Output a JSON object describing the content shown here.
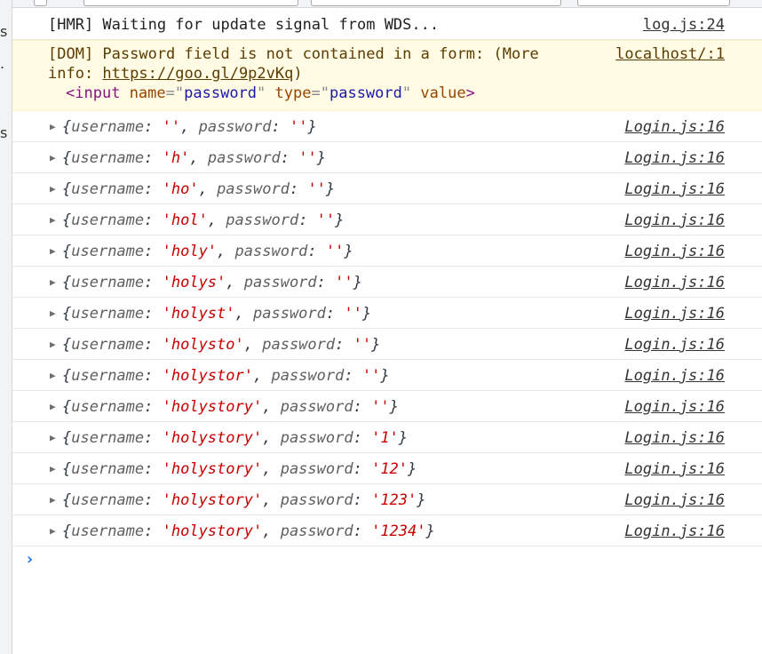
{
  "left_strip": [
    "s",
    ".",
    "s"
  ],
  "messages": {
    "hmr": {
      "text": "[HMR] Waiting for update signal from WDS...",
      "source": "log.js:24"
    },
    "dom_warning": {
      "text_part1": "[DOM] Password field is not contained in a form: (More",
      "text_part2": "info: ",
      "link": "https://goo.gl/9p2vKq",
      "text_part3": ")",
      "element": {
        "open": "<",
        "tag": "input",
        "name_attr": "name",
        "name_eq": "=",
        "name_q1": "\"",
        "name_val": "password",
        "name_q2": "\"",
        "type_attr": "type",
        "type_eq": "=",
        "type_q1": "\"",
        "type_val": "password",
        "type_q2": "\"",
        "value_attr": "value",
        "close": ">"
      },
      "source": "localhost/:1"
    }
  },
  "log_entries": [
    {
      "open": "{",
      "k1": "username",
      "c1": ": ",
      "v1": "''",
      "sep": ", ",
      "k2": "password",
      "c2": ": ",
      "v2": "''",
      "close": "}",
      "source": "Login.js:16"
    },
    {
      "open": "{",
      "k1": "username",
      "c1": ": ",
      "v1": "'h'",
      "sep": ", ",
      "k2": "password",
      "c2": ": ",
      "v2": "''",
      "close": "}",
      "source": "Login.js:16"
    },
    {
      "open": "{",
      "k1": "username",
      "c1": ": ",
      "v1": "'ho'",
      "sep": ", ",
      "k2": "password",
      "c2": ": ",
      "v2": "''",
      "close": "}",
      "source": "Login.js:16"
    },
    {
      "open": "{",
      "k1": "username",
      "c1": ": ",
      "v1": "'hol'",
      "sep": ", ",
      "k2": "password",
      "c2": ": ",
      "v2": "''",
      "close": "}",
      "source": "Login.js:16"
    },
    {
      "open": "{",
      "k1": "username",
      "c1": ": ",
      "v1": "'holy'",
      "sep": ", ",
      "k2": "password",
      "c2": ": ",
      "v2": "''",
      "close": "}",
      "source": "Login.js:16"
    },
    {
      "open": "{",
      "k1": "username",
      "c1": ": ",
      "v1": "'holys'",
      "sep": ", ",
      "k2": "password",
      "c2": ": ",
      "v2": "''",
      "close": "}",
      "source": "Login.js:16"
    },
    {
      "open": "{",
      "k1": "username",
      "c1": ": ",
      "v1": "'holyst'",
      "sep": ", ",
      "k2": "password",
      "c2": ": ",
      "v2": "''",
      "close": "}",
      "source": "Login.js:16"
    },
    {
      "open": "{",
      "k1": "username",
      "c1": ": ",
      "v1": "'holysto'",
      "sep": ", ",
      "k2": "password",
      "c2": ": ",
      "v2": "''",
      "close": "}",
      "source": "Login.js:16"
    },
    {
      "open": "{",
      "k1": "username",
      "c1": ": ",
      "v1": "'holystor'",
      "sep": ", ",
      "k2": "password",
      "c2": ": ",
      "v2": "''",
      "close": "}",
      "source": "Login.js:16"
    },
    {
      "open": "{",
      "k1": "username",
      "c1": ": ",
      "v1": "'holystory'",
      "sep": ", ",
      "k2": "password",
      "c2": ": ",
      "v2": "''",
      "close": "}",
      "source": "Login.js:16"
    },
    {
      "open": "{",
      "k1": "username",
      "c1": ": ",
      "v1": "'holystory'",
      "sep": ", ",
      "k2": "password",
      "c2": ": ",
      "v2": "'1'",
      "close": "}",
      "source": "Login.js:16"
    },
    {
      "open": "{",
      "k1": "username",
      "c1": ": ",
      "v1": "'holystory'",
      "sep": ", ",
      "k2": "password",
      "c2": ": ",
      "v2": "'12'",
      "close": "}",
      "source": "Login.js:16"
    },
    {
      "open": "{",
      "k1": "username",
      "c1": ": ",
      "v1": "'holystory'",
      "sep": ", ",
      "k2": "password",
      "c2": ": ",
      "v2": "'123'",
      "close": "}",
      "source": "Login.js:16"
    },
    {
      "open": "{",
      "k1": "username",
      "c1": ": ",
      "v1": "'holystory'",
      "sep": ", ",
      "k2": "password",
      "c2": ": ",
      "v2": "'1234'",
      "close": "}",
      "source": "Login.js:16"
    }
  ],
  "prompt": {
    "caret": "›",
    "value": ""
  },
  "icons": {
    "expand": "triangle-right-icon",
    "prompt": "chevron-right-icon"
  },
  "colors": {
    "string": "#c80000",
    "warning_bg": "#fffbe5",
    "warning_text": "#5c3c00",
    "prompt_caret": "#1a73e8"
  }
}
